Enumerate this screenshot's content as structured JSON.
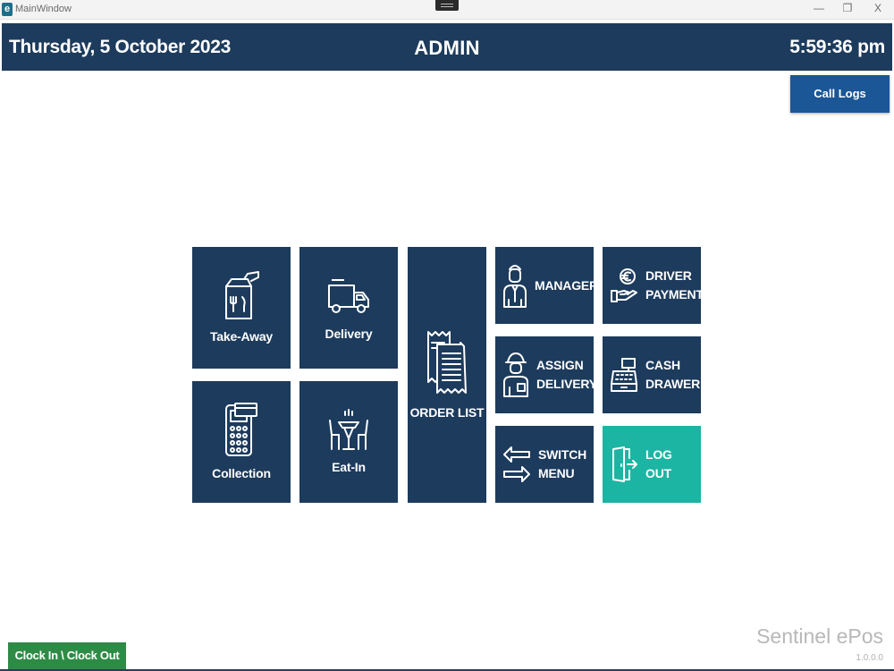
{
  "window": {
    "title": "MainWindow",
    "app_icon_letter": "e",
    "minimize_glyph": "—",
    "restore_glyph": "❐",
    "close_glyph": "X"
  },
  "header": {
    "date": "Thursday, 5 October 2023",
    "user": "ADMIN",
    "time": "5:59:36 pm",
    "background": "#1d3b5c"
  },
  "call_logs_label": "Call Logs",
  "tiles": {
    "takeaway": {
      "label": "Take-Away",
      "icon": "takeaway-bag-icon"
    },
    "delivery": {
      "label": "Delivery",
      "icon": "delivery-truck-icon"
    },
    "collection": {
      "label": "Collection",
      "icon": "card-terminal-icon"
    },
    "eatin": {
      "label": "Eat-In",
      "icon": "dining-table-icon"
    },
    "orderlist": {
      "label": "ORDER LIST",
      "icon": "receipts-icon"
    },
    "manager": {
      "label": "MANAGER",
      "icon": "manager-person-icon"
    },
    "assign": {
      "line1": "ASSIGN",
      "line2": "DELIVERY",
      "icon": "courier-person-icon"
    },
    "switch": {
      "line1": "SWITCH",
      "line2": "MENU",
      "icon": "swap-arrows-icon"
    },
    "driverpay": {
      "line1": "DRIVER",
      "line2": "PAYMENT",
      "icon": "euro-hand-icon"
    },
    "cashdrawer": {
      "line1": "CASH",
      "line2": "DRAWER",
      "icon": "cash-register-icon"
    },
    "logout": {
      "label": "LOG OUT",
      "icon": "door-exit-icon",
      "color": "#1cb5a3"
    }
  },
  "footer": {
    "clock_label": "Clock In \\ Clock Out",
    "brand": "Sentinel ePos",
    "version": "1.0.0.0"
  }
}
